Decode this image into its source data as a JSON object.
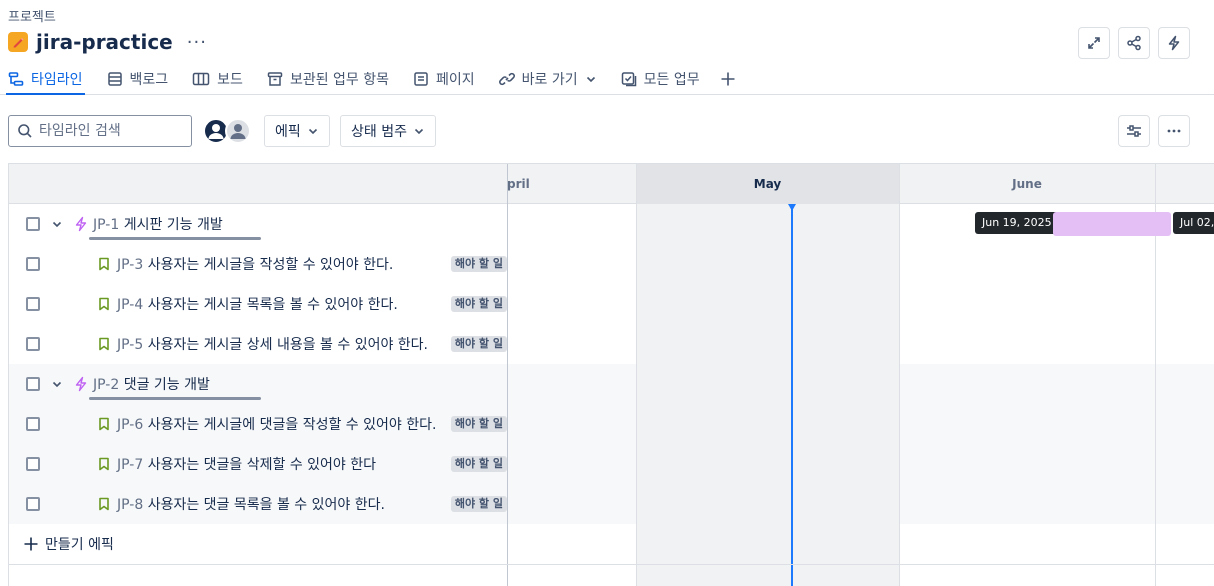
{
  "breadcrumb": "프로젝트",
  "project": {
    "name": "jira-practice",
    "more": "···"
  },
  "top_actions": [
    "expand-icon",
    "share-icon",
    "lightning-icon"
  ],
  "tabs": [
    {
      "label": "타임라인",
      "icon": "timeline-icon",
      "active": true
    },
    {
      "label": "백로그",
      "icon": "backlog-icon"
    },
    {
      "label": "보드",
      "icon": "board-icon"
    },
    {
      "label": "보관된 업무 항목",
      "icon": "archive-icon"
    },
    {
      "label": "페이지",
      "icon": "page-icon"
    },
    {
      "label": "바로 가기",
      "icon": "link-icon",
      "dropdown": true
    },
    {
      "label": "모든 업무",
      "icon": "tasks-icon"
    }
  ],
  "toolbar": {
    "search_placeholder": "타임라인 검색",
    "epic_filter": "에픽",
    "status_filter": "상태 범주"
  },
  "timeline": {
    "months": [
      "pril",
      "May",
      "June"
    ],
    "current_month": "May"
  },
  "epics": [
    {
      "key": "JP-1",
      "summary": "게시판 기능 개발",
      "bar_start": "Jun 19, 2025",
      "bar_end": "Jul 02,",
      "stories": [
        {
          "key": "JP-3",
          "summary": "사용자는 게시글을 작성할 수 있어야 한다.",
          "status": "해야 할 일"
        },
        {
          "key": "JP-4",
          "summary": "사용자는 게시글 목록을 볼 수 있어야 한다.",
          "status": "해야 할 일"
        },
        {
          "key": "JP-5",
          "summary": "사용자는 게시글 상세 내용을 볼 수 있어야 한다.",
          "status": "해야 할 일"
        }
      ]
    },
    {
      "key": "JP-2",
      "summary": "댓글 기능 개발",
      "stories": [
        {
          "key": "JP-6",
          "summary": "사용자는 게시글에 댓글을 작성할 수 있어야 한다.",
          "status": "해야 할 일"
        },
        {
          "key": "JP-7",
          "summary": "사용자는 댓글을 삭제할 수 있어야 한다",
          "status": "해야 할 일"
        },
        {
          "key": "JP-8",
          "summary": "사용자는 댓글 목록을 볼 수 있어야 한다.",
          "status": "해야 할 일"
        }
      ]
    }
  ],
  "create_epic": "만들기 에픽",
  "colors": {
    "accent": "#0c66e4",
    "today": "#1d7afc",
    "epic": "#bf63f3",
    "story": "#6a9a23",
    "bar": "#e4bff5"
  }
}
